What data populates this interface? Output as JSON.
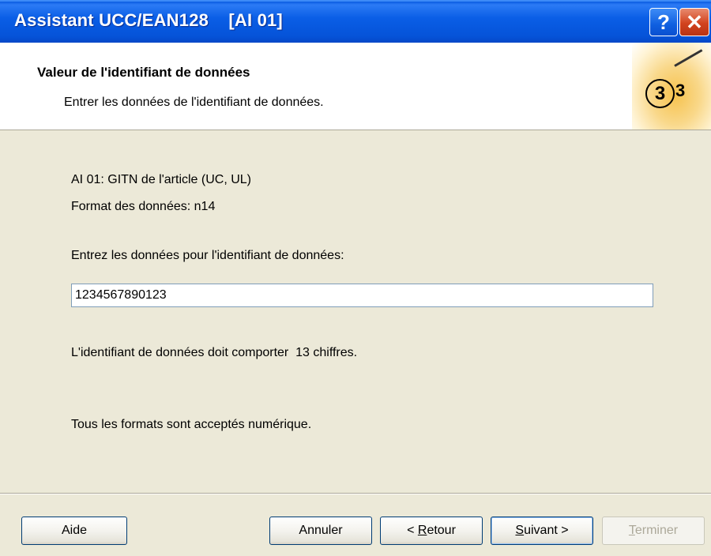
{
  "window": {
    "title": "Assistant UCC/EAN128    [AI 01]",
    "help_label": "?",
    "close_label": "✕"
  },
  "header": {
    "title": "Valeur de l'identifiant de données",
    "subtitle": "Entrer les données de l'identifiant de données.",
    "step_current": "3",
    "step_total": "3"
  },
  "content": {
    "ai_line": "AI 01: GITN de l'article (UC, UL)",
    "format_line": "Format des données: n14",
    "prompt": "Entrez les données pour l'identifiant de données:",
    "input_value": "1234567890123",
    "digits_note": "L'identifiant de données doit comporter  13 chiffres.",
    "formats_note": "Tous les formats sont acceptés numérique."
  },
  "buttons": {
    "help": "Aide",
    "cancel": "Annuler",
    "back_prefix": "< ",
    "back_mnemonic": "R",
    "back_rest": "etour",
    "next_mnemonic": "S",
    "next_rest": "uivant >",
    "finish_mnemonic": "T",
    "finish_rest": "erminer"
  }
}
